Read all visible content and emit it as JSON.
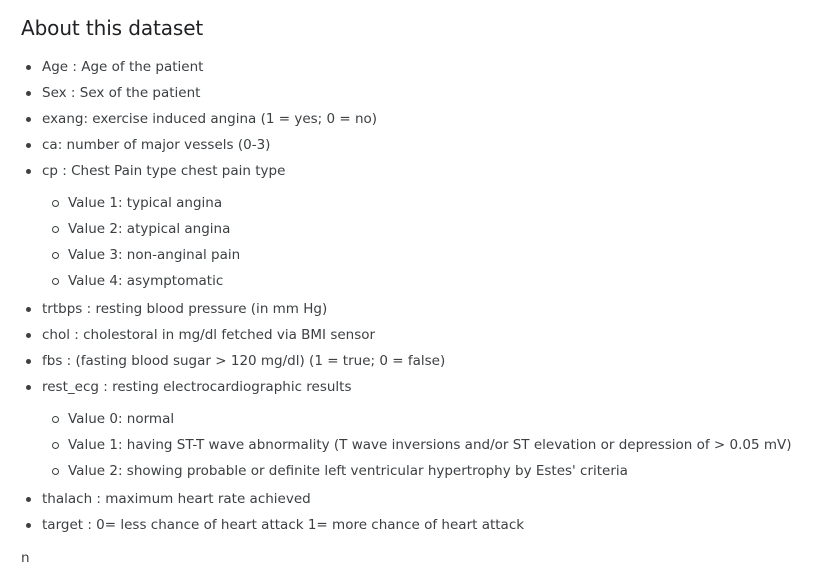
{
  "title": "About this dataset",
  "items": [
    {
      "text": "Age : Age of the patient"
    },
    {
      "text": "Sex : Sex of the patient"
    },
    {
      "text": "exang: exercise induced angina (1 = yes; 0 = no)"
    },
    {
      "text": "ca: number of major vessels (0-3)"
    },
    {
      "text": "cp : Chest Pain type chest pain type",
      "sub": [
        "Value 1: typical angina",
        "Value 2: atypical angina",
        "Value 3: non-anginal pain",
        "Value 4: asymptomatic"
      ]
    },
    {
      "text": "trtbps : resting blood pressure (in mm Hg)"
    },
    {
      "text": "chol : cholestoral in mg/dl fetched via BMI sensor"
    },
    {
      "text": "fbs : (fasting blood sugar > 120 mg/dl) (1 = true; 0 = false)"
    },
    {
      "text": "rest_ecg : resting electrocardiographic results",
      "sub": [
        "Value 0: normal",
        "Value 1: having ST-T wave abnormality (T wave inversions and/or ST elevation or depression of > 0.05 mV)",
        "Value 2: showing probable or definite left ventricular hypertrophy by Estes' criteria"
      ]
    },
    {
      "text": "thalach : maximum heart rate achieved"
    },
    {
      "text": "target : 0= less chance of heart attack 1= more chance of heart attack"
    }
  ],
  "trailing_text": "n"
}
